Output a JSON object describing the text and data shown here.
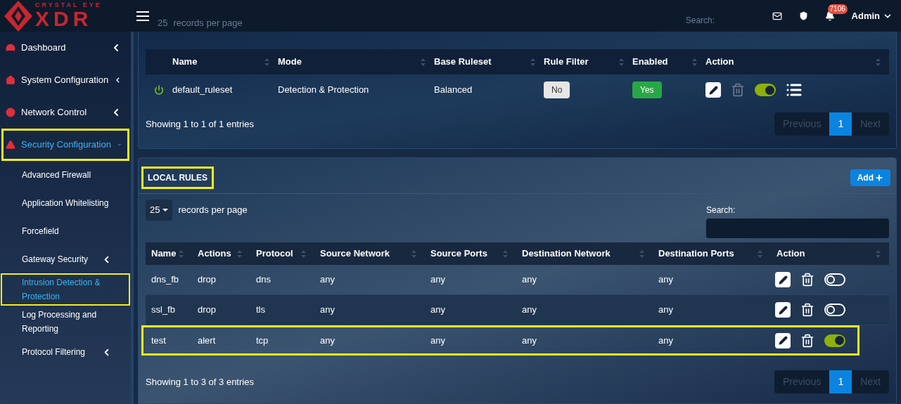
{
  "logo": {
    "tagline": "CRYSTAL EYE",
    "name": "XDR"
  },
  "header": {
    "notifications": "7106",
    "user": "Admin",
    "behind_header": {
      "records_select": "25",
      "records_label": "records per page",
      "search_label": "Search:"
    }
  },
  "sidebar": {
    "items": [
      {
        "label": "Dashboard",
        "expanded": false,
        "selected": false,
        "highlighted": false
      },
      {
        "label": "System Configuration",
        "expanded": false,
        "selected": false,
        "highlighted": false
      },
      {
        "label": "Network Control",
        "expanded": false,
        "selected": false,
        "highlighted": false
      },
      {
        "label": "Security Configuration",
        "expanded": true,
        "selected": true,
        "highlighted": true,
        "children": [
          {
            "label": "Advanced Firewall",
            "has_submenu": false,
            "selected": false,
            "highlighted": false
          },
          {
            "label": "Application Whitelisting",
            "has_submenu": false,
            "selected": false,
            "highlighted": false
          },
          {
            "label": "Forcefield",
            "has_submenu": false,
            "selected": false,
            "highlighted": false
          },
          {
            "label": "Gateway Security",
            "has_submenu": true,
            "selected": false,
            "highlighted": false
          },
          {
            "label": "Intrusion Detection & Protection",
            "has_submenu": false,
            "selected": true,
            "highlighted": true
          },
          {
            "label": "Log Processing and Reporting",
            "has_submenu": false,
            "selected": false,
            "highlighted": false
          },
          {
            "label": "Protocol Filtering",
            "has_submenu": true,
            "selected": false,
            "highlighted": false
          }
        ]
      }
    ]
  },
  "rulesets": {
    "columns": [
      "Name",
      "Mode",
      "Base Ruleset",
      "Rule Filter",
      "Enabled",
      "Action"
    ],
    "rows": [
      {
        "active": true,
        "name": "default_ruleset",
        "mode": "Detection & Protection",
        "base_ruleset": "Balanced",
        "rule_filter": "No",
        "enabled": "Yes",
        "on": true
      }
    ],
    "info": "Showing 1 to 1 of 1 entries",
    "pagination": {
      "previous": "Previous",
      "pages": [
        {
          "label": "1",
          "selected": true
        }
      ],
      "next": "Next"
    }
  },
  "local_rules": {
    "title": "LOCAL RULES",
    "title_highlighted": true,
    "add_button": "Add",
    "records_select": "25",
    "records_label": "records per page",
    "search_label": "Search:",
    "columns": [
      "Name",
      "Actions",
      "Protocol",
      "Source Network",
      "Source Ports",
      "Destination Network",
      "Destination Ports",
      "Action"
    ],
    "rows": [
      {
        "cells": [
          "dns_fb",
          "drop",
          "dns",
          "any",
          "any",
          "any",
          "any"
        ],
        "on": false,
        "highlighted": false
      },
      {
        "cells": [
          "ssl_fb",
          "drop",
          "tls",
          "any",
          "any",
          "any",
          "any"
        ],
        "on": false,
        "highlighted": false
      },
      {
        "cells": [
          "test",
          "alert",
          "tcp",
          "any",
          "any",
          "any",
          "any"
        ],
        "on": true,
        "highlighted": true
      }
    ],
    "info": "Showing 1 to 3 of 3 entries",
    "pagination": {
      "previous": "Previous",
      "pages": [
        {
          "label": "1",
          "selected": true
        }
      ],
      "next": "Next"
    }
  }
}
